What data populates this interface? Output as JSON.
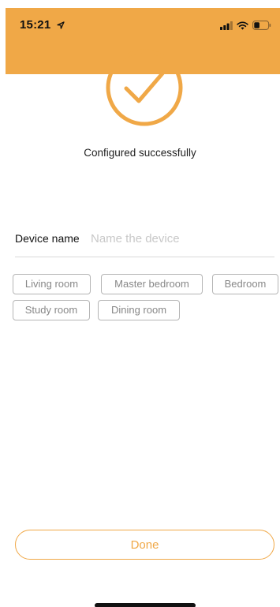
{
  "status_bar": {
    "time": "15:21",
    "location_icon": "location-arrow-icon",
    "signal_icon": "cellular-signal-icon",
    "wifi_icon": "wifi-icon",
    "battery_icon": "battery-icon",
    "battery_level": 0.4
  },
  "theme": {
    "accent": "#f0a847",
    "header_bg": "#f0a847",
    "tag_border": "#b5b5b5",
    "placeholder": "#c8c8c8"
  },
  "success": {
    "icon": "checkmark-circle-icon",
    "message": "Configured successfully"
  },
  "device": {
    "label": "Device name",
    "placeholder": "Name the device",
    "value": ""
  },
  "room_tags": [
    "Living room",
    "Master bedroom",
    "Bedroom",
    "Study room",
    "Dining room"
  ],
  "footer": {
    "done_label": "Done"
  }
}
